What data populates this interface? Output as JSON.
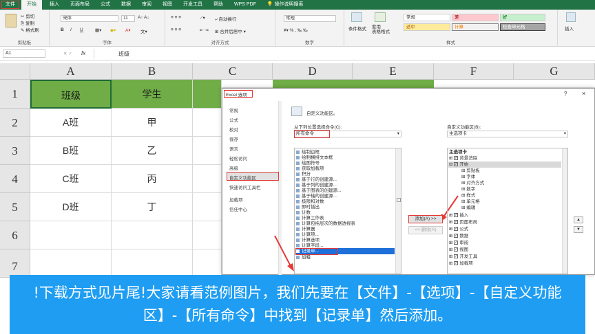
{
  "tabs": [
    "文件",
    "开始",
    "插入",
    "页面布局",
    "公式",
    "数据",
    "审阅",
    "视图",
    "开发工具",
    "帮助",
    "WPS PDF",
    "操作说明搜索"
  ],
  "ribbon": {
    "clipboard": {
      "cut": "剪切",
      "copy": "复制",
      "painter": "格式刷",
      "group": "剪贴板"
    },
    "font": {
      "name": "宋体",
      "size": "11",
      "bold": "B",
      "italic": "I",
      "underline": "U",
      "group": "字体"
    },
    "align": {
      "wrap": "自动换行",
      "merge": "合并后居中",
      "group": "对齐方式"
    },
    "number": {
      "format": "常规",
      "group": "数字"
    },
    "styles": {
      "conditional": "条件格式",
      "table": "套用\n表格格式",
      "normal": "常规",
      "bad": "差",
      "good": "好",
      "neutral": "适中",
      "calc": "计算",
      "check": "检查单元格",
      "group": "样式"
    },
    "cells": {
      "insert": "插入"
    }
  },
  "formula_bar": {
    "namebox": "A1",
    "fx": "fx",
    "content": "班级"
  },
  "columns": [
    "A",
    "B",
    "C",
    "D",
    "E",
    "F",
    "G"
  ],
  "rows": [
    "1",
    "2",
    "3",
    "4",
    "5",
    "6",
    "7"
  ],
  "cells": [
    [
      "班级",
      "学生"
    ],
    [
      "A班",
      "甲"
    ],
    [
      "B班",
      "乙"
    ],
    [
      "C班",
      "丙"
    ],
    [
      "D班",
      "丁"
    ]
  ],
  "dialog": {
    "title": "Excel 选项",
    "help": "?",
    "close": "×",
    "nav": [
      "常规",
      "公式",
      "校对",
      "保存",
      "语言",
      "轻松访问",
      "高级",
      "自定义功能区",
      "快速访问工具栏",
      "加载项",
      "信任中心"
    ],
    "heading": "自定义功能区。",
    "from_label": "从下列位置选择命令(C):",
    "from_value": "所有命令",
    "custom_label": "自定义功能区(B):",
    "custom_value": "主选项卡",
    "commands": [
      "绘制边框",
      "绘制横排文本框",
      "绘图符号",
      "获取加载项",
      "积分",
      "基于行的创建源...",
      "基于列的创建源...",
      "基于图表的创建源...",
      "基于轴的创建源...",
      "极限和对数",
      "即时插出",
      "计数",
      "计算工作表",
      "计算包括层次的数据透视表",
      "计算器",
      "计算项...",
      "计算选项",
      "计算字段...",
      "记录单...",
      "加粗"
    ],
    "add_btn": "添加(A) >>",
    "remove_btn": "<< 删除(R)",
    "tree_title": "主选项卡",
    "tree": [
      "背景消除",
      "开始",
      "剪贴板",
      "字体",
      "对齐方式",
      "数字",
      "样式",
      "单元格",
      "编辑",
      "插入",
      "页面布局",
      "公式",
      "数据",
      "审阅",
      "视图",
      "开发工具",
      "加载项"
    ]
  },
  "banner": "!下载方式见片尾!大家请看范例图片，我们先要在【文件】-【选项】-【自定义功能区】-【所有命令】中找到【记录单】然后添加。"
}
